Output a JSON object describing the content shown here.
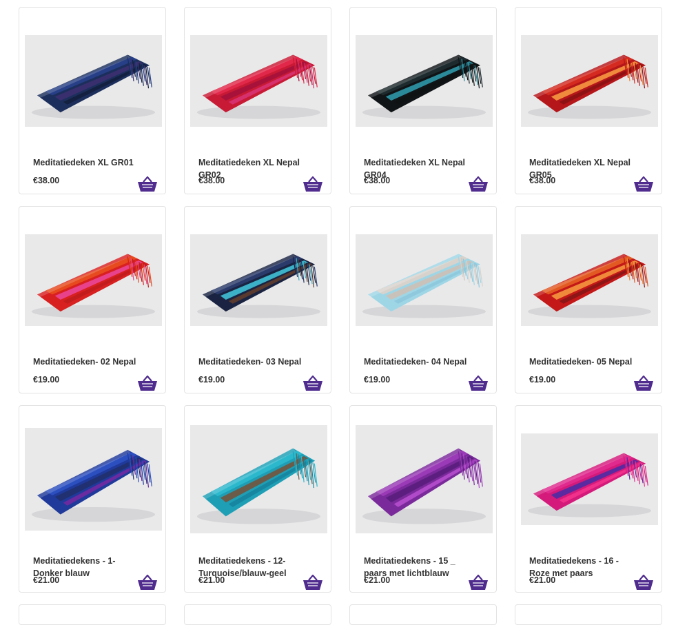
{
  "products": [
    {
      "name": "Meditatiedeken XL GR01",
      "price": "€38.00",
      "colors": [
        "#1c2f5c",
        "#273f86",
        "#3a2f6e",
        "#14203f"
      ]
    },
    {
      "name": "Meditatiedeken XL Nepal GR02",
      "price": "€38.00",
      "colors": [
        "#c81a35",
        "#e2284a",
        "#a8123a",
        "#d6306e"
      ]
    },
    {
      "name": "Meditatiedeken XL Nepal GR04",
      "price": "€38.00",
      "colors": [
        "#111416",
        "#1d2a2e",
        "#2a8a9a",
        "#0f1213"
      ]
    },
    {
      "name": "Meditatiedeken XL Nepal GR05",
      "price": "€38.00",
      "colors": [
        "#b5161a",
        "#d42a1f",
        "#f08a3c",
        "#8e1214"
      ]
    },
    {
      "name": "Meditatiedeken- 02 Nepal",
      "price": "€19.00",
      "colors": [
        "#d82020",
        "#e64a1e",
        "#e8428c",
        "#c21c1c"
      ]
    },
    {
      "name": "Meditatiedeken- 03 Nepal",
      "price": "€19.00",
      "colors": [
        "#1a2442",
        "#2a3a6a",
        "#3bb0c6",
        "#5a3a2e"
      ]
    },
    {
      "name": "Meditatiedeken- 04 Nepal",
      "price": "€19.00",
      "colors": [
        "#9fd6e6",
        "#d8d2cc",
        "#c9c2bb",
        "#8fc9dd"
      ]
    },
    {
      "name": "Meditatiedeken- 05 Nepal",
      "price": "€19.00",
      "colors": [
        "#c41818",
        "#e25a22",
        "#f0893a",
        "#8d1616"
      ]
    },
    {
      "name": "Meditatiedekens - 1- Donker blauw",
      "price": "€21.00",
      "colors": [
        "#1f3a9a",
        "#2c4fc0",
        "#203070",
        "#6a2aa0"
      ]
    },
    {
      "name": "Meditatiedekens - 12- Turquoise/blauw-geel",
      "price": "€21.00",
      "colors": [
        "#1e9fb6",
        "#2cb8cc",
        "#6b5c4a",
        "#1786a0"
      ]
    },
    {
      "name": "Meditatiedekens - 15 _ paars met lichtblauw",
      "price": "€21.00",
      "colors": [
        "#7a2a9a",
        "#9a3ab6",
        "#5c1f80",
        "#b04ac8"
      ]
    },
    {
      "name": "Meditatiedekens - 16 - Roze met paars",
      "price": "€21.00",
      "colors": [
        "#d41a7a",
        "#e02a8e",
        "#5a2aa0",
        "#f0308a"
      ]
    }
  ],
  "colors": {
    "basket": "#4f2c8e",
    "card_border": "#e3e3e3"
  },
  "icons": {
    "basket": "basket-icon"
  }
}
